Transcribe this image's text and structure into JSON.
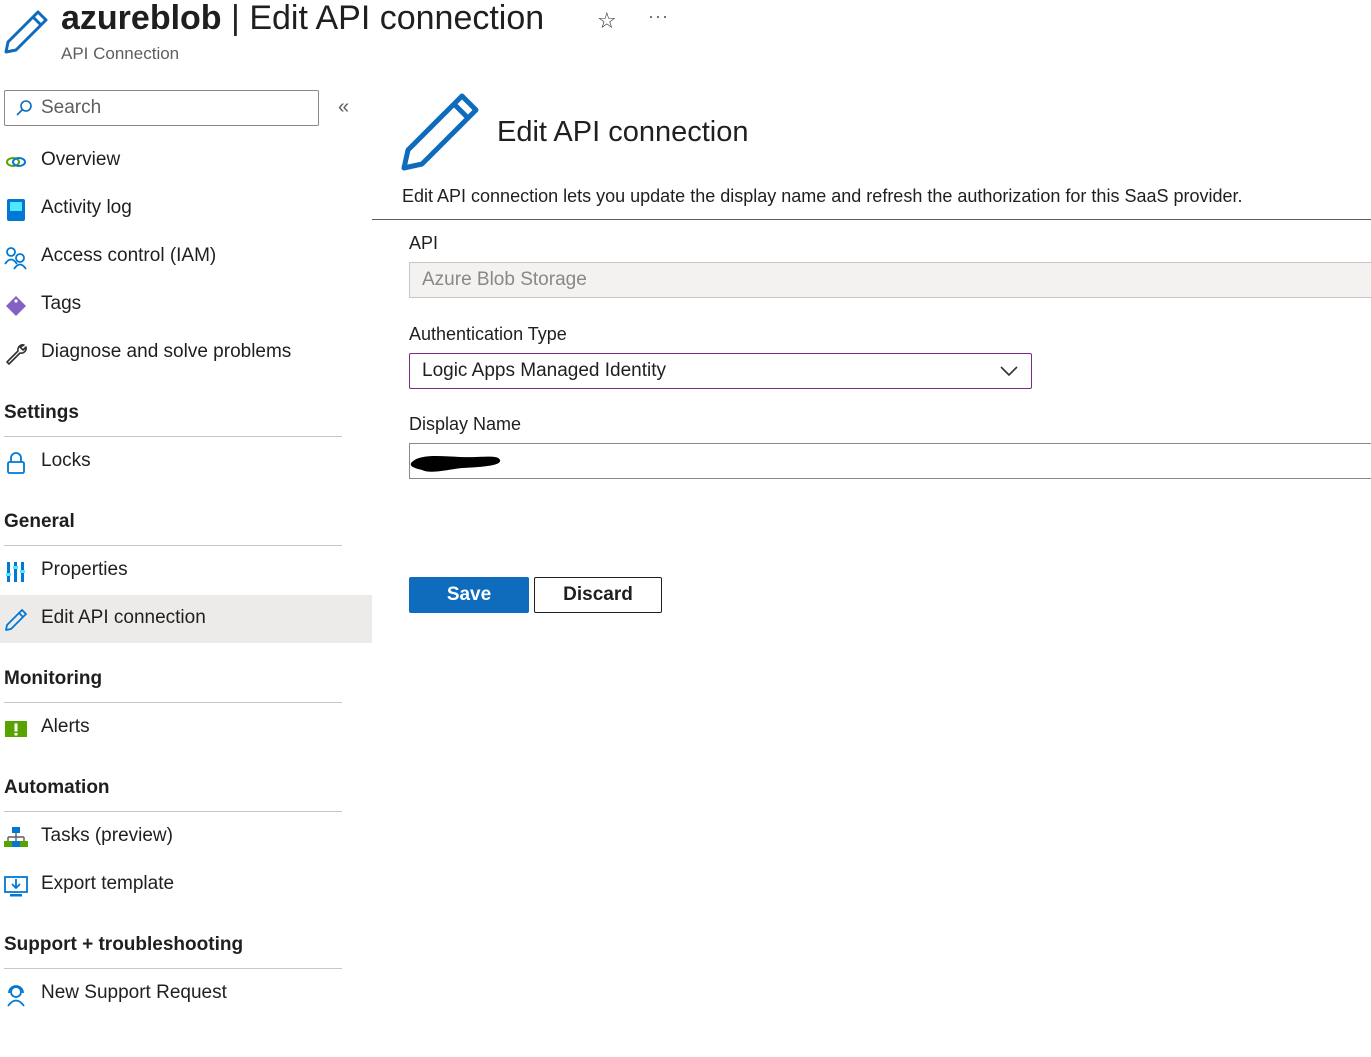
{
  "header": {
    "resource_name": "azureblob",
    "separator": " | ",
    "page_name": "Edit API connection",
    "subtitle": "API Connection",
    "star_glyph": "☆",
    "more_glyph": "···",
    "icon": "pencil-icon"
  },
  "sidebar": {
    "search_placeholder": "Search",
    "collapse_glyph": "«",
    "top_items": [
      {
        "label": "Overview",
        "icon": "overview-icon"
      },
      {
        "label": "Activity log",
        "icon": "activity-log-icon"
      },
      {
        "label": "Access control (IAM)",
        "icon": "iam-icon"
      },
      {
        "label": "Tags",
        "icon": "tag-icon"
      },
      {
        "label": "Diagnose and solve problems",
        "icon": "wrench-icon"
      }
    ],
    "sections": [
      {
        "title": "Settings",
        "items": [
          {
            "label": "Locks",
            "icon": "lock-icon"
          }
        ]
      },
      {
        "title": "General",
        "items": [
          {
            "label": "Properties",
            "icon": "properties-icon"
          },
          {
            "label": "Edit API connection",
            "icon": "pencil-icon",
            "active": true
          }
        ]
      },
      {
        "title": "Monitoring",
        "items": [
          {
            "label": "Alerts",
            "icon": "alert-icon"
          }
        ]
      },
      {
        "title": "Automation",
        "items": [
          {
            "label": "Tasks (preview)",
            "icon": "tasks-icon"
          },
          {
            "label": "Export template",
            "icon": "export-template-icon"
          }
        ]
      },
      {
        "title": "Support + troubleshooting",
        "items": [
          {
            "label": "New Support Request",
            "icon": "support-icon"
          }
        ]
      }
    ]
  },
  "main": {
    "title": "Edit API connection",
    "description": "Edit API connection lets you update the display name and refresh the authorization for this SaaS provider.",
    "api_label": "API",
    "api_value": "Azure Blob Storage",
    "auth_label": "Authentication Type",
    "auth_value": "Logic Apps Managed Identity",
    "display_name_label": "Display Name",
    "display_name_value": "",
    "save_label": "Save",
    "discard_label": "Discard"
  },
  "colors": {
    "accent": "#0f6cbd",
    "select_border": "#7a2a87",
    "active_bg": "#edebe9"
  }
}
